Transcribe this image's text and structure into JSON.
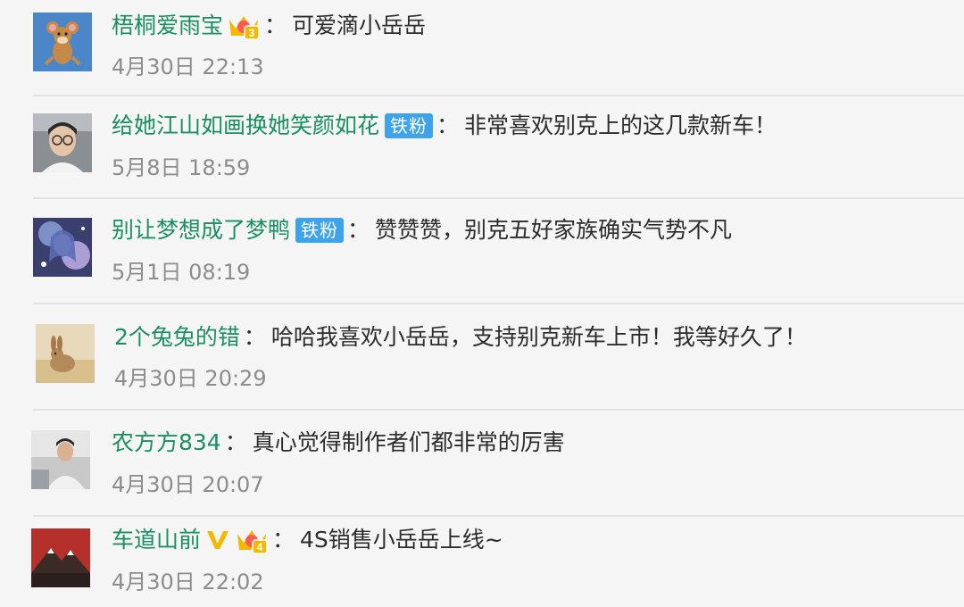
{
  "comments": [
    {
      "user": "梧桐爱雨宝",
      "text": "可爱滴小岳岳",
      "time": "4月30日 22:13",
      "badges": [
        "crown-3"
      ],
      "avatar": "cartoon-mouse-avatar"
    },
    {
      "user": "给她江山如画换她笑颜如花",
      "text": "非常喜欢别克上的这几款新车！",
      "time": "5月8日 18:59",
      "badges": [
        "铁粉"
      ],
      "avatar": "person-glasses-avatar"
    },
    {
      "user": "别让梦想成了梦鸭",
      "text": "赞赞赞，别克五好家族确实气势不凡",
      "time": "5月1日 08:19",
      "badges": [
        "铁粉"
      ],
      "avatar": "anime-girl-avatar"
    },
    {
      "user": "2个兔兔的错",
      "text": "哈哈我喜欢小岳岳，支持别克新车上市！我等好久了！",
      "time": "4月30日 20:29",
      "badges": [],
      "avatar": "bunny-photo-avatar"
    },
    {
      "user": "农方方834",
      "text": "真心觉得制作者们都非常的厉害",
      "time": "4月30日 20:07",
      "badges": [],
      "avatar": "person-photo-avatar"
    },
    {
      "user": "车道山前",
      "text": "4S销售小岳岳上线~",
      "time": "4月30日 22:02",
      "badges": [
        "verified-v",
        "crown-4"
      ],
      "avatar": "mountain-logo-avatar"
    }
  ],
  "colors": {
    "username": "#1a8f64",
    "text": "#2c2c2c",
    "time": "#8c8c8c",
    "iron_fan_badge": "#3fa3ec",
    "crown": "#f5b800",
    "verified": "#f5b800",
    "background": "#f5f5f5"
  },
  "badge_labels": {
    "iron_fan": "铁粉",
    "crown_level_1": "3",
    "crown_level_6": "4"
  }
}
